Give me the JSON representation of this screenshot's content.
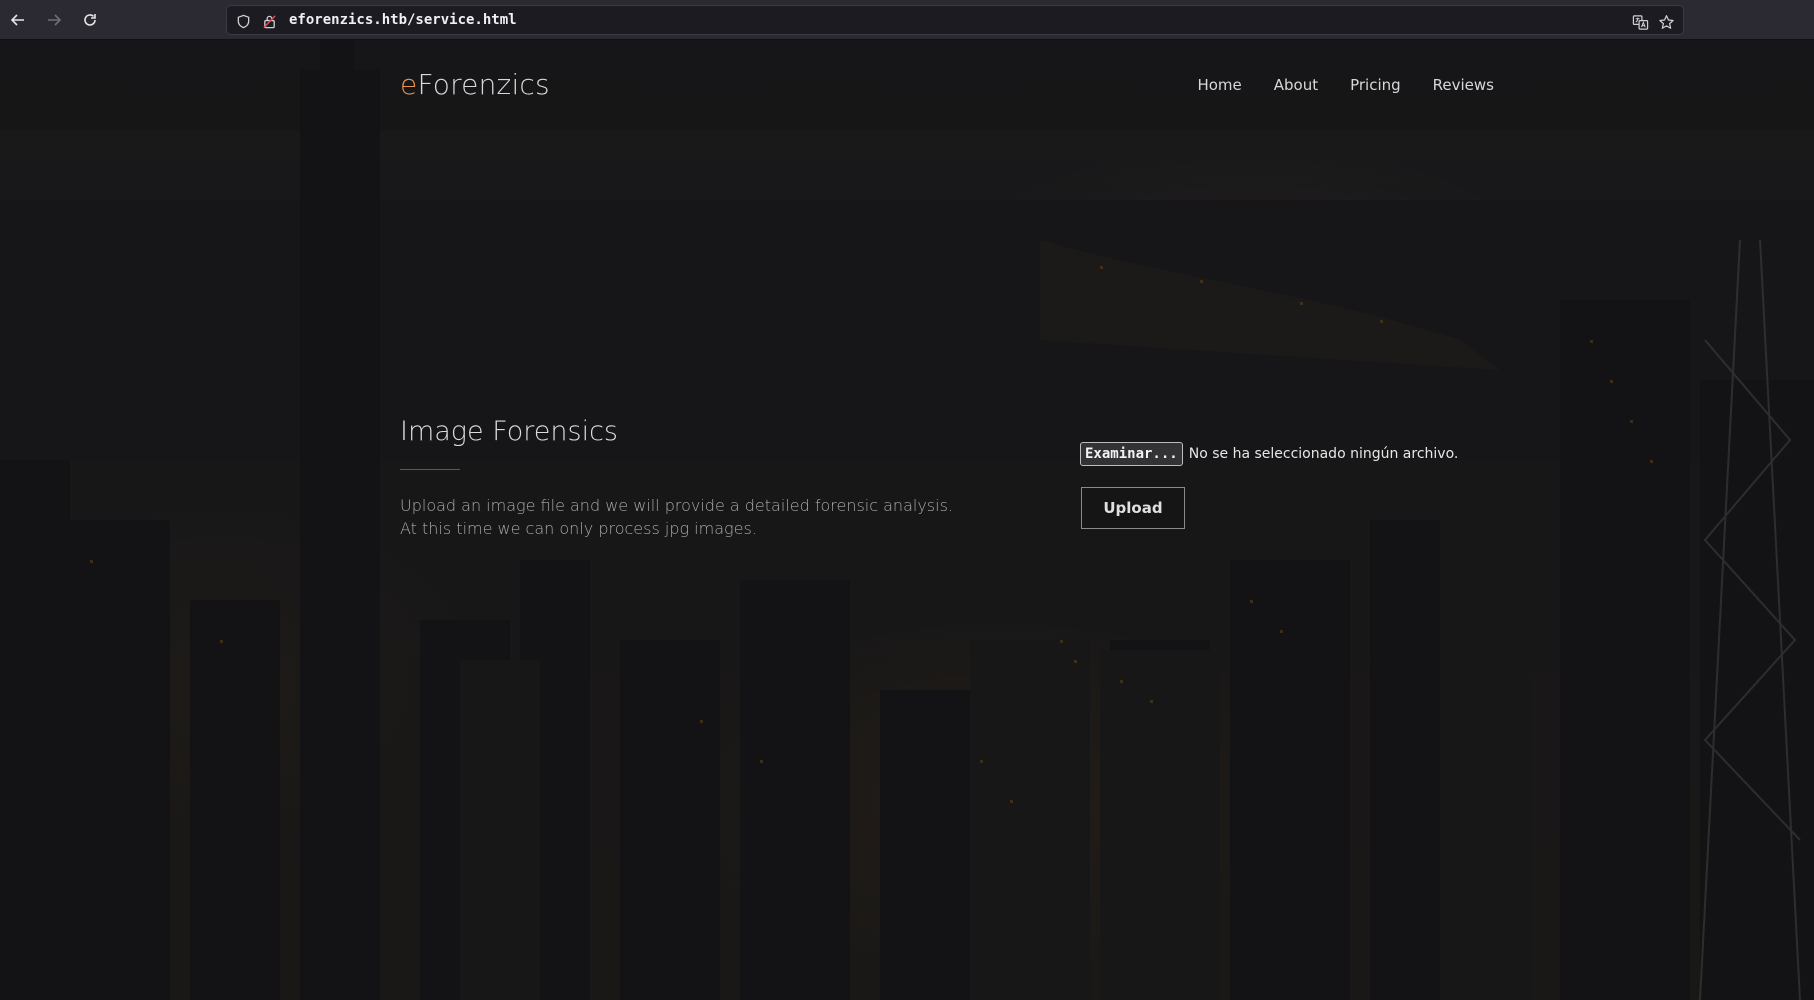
{
  "browser": {
    "back_icon": "arrow-left-icon",
    "forward_icon": "arrow-right-icon",
    "reload_icon": "reload-icon",
    "url": "eforenzics.htb/service.html"
  },
  "site": {
    "brand_accent": "e",
    "brand_rest": "Forenzics",
    "accent_color": "#e8934a",
    "nav": [
      {
        "label": "Home"
      },
      {
        "label": "About"
      },
      {
        "label": "Pricing"
      },
      {
        "label": "Reviews"
      }
    ]
  },
  "section": {
    "title": "Image Forensics",
    "description_line1": "Upload an image file and we will provide a detailed forensic analysis.",
    "description_line2": "At this time we can only process jpg images."
  },
  "upload_form": {
    "browse_label": "Examinar...",
    "file_status": "No se ha seleccionado ningún archivo.",
    "upload_label": "Upload"
  }
}
